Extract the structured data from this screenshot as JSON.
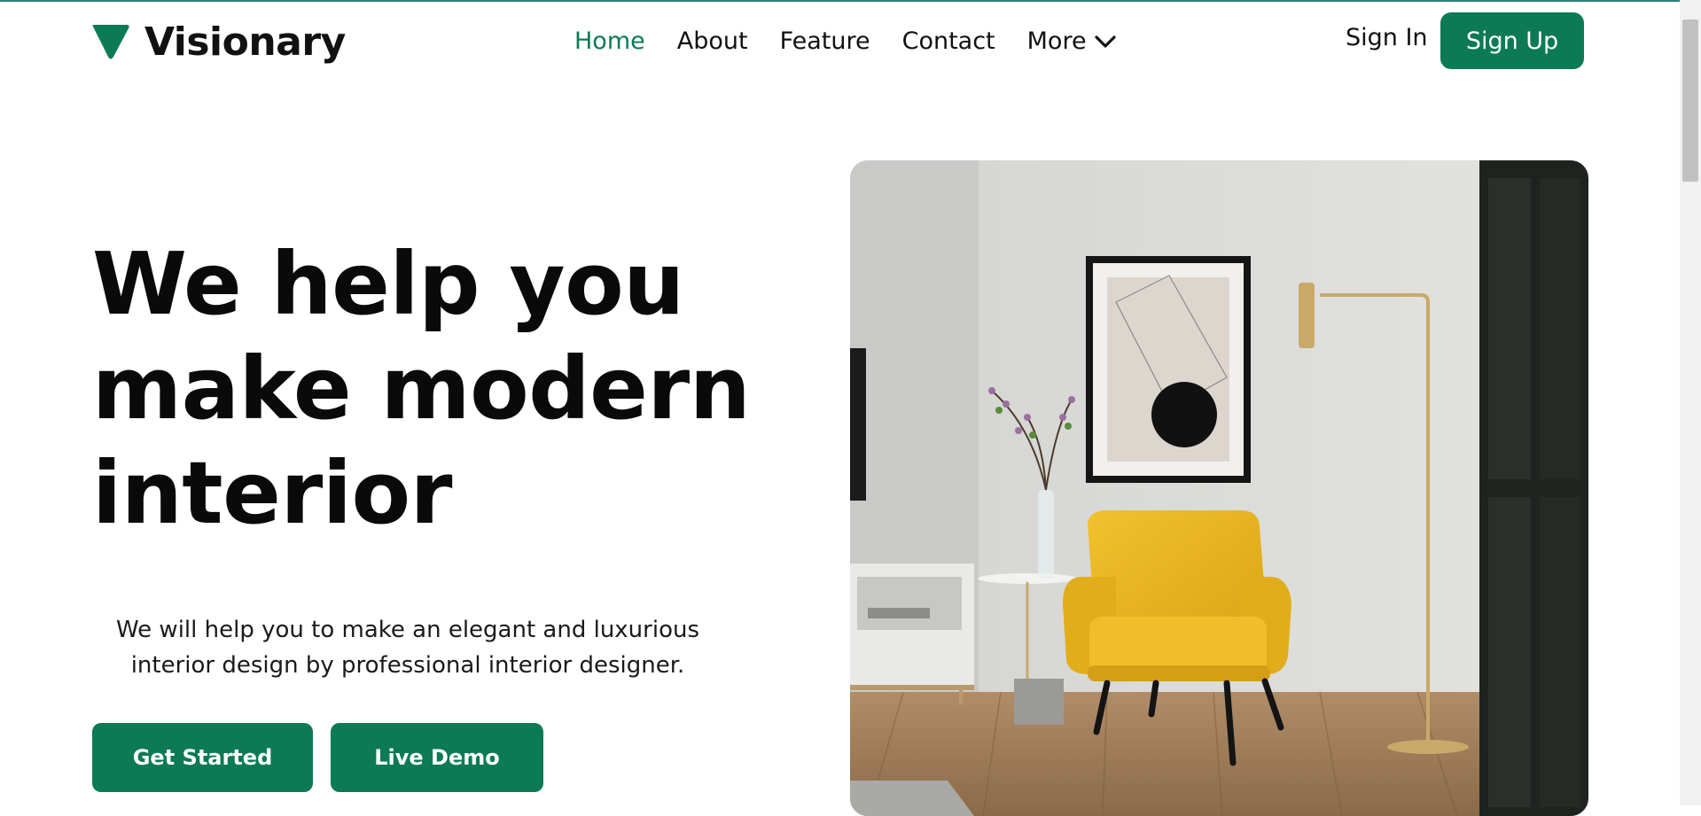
{
  "brand": {
    "name": "Visionary",
    "accent_color": "#0b7a55",
    "logo_icon": "triangle-logo-icon"
  },
  "nav": {
    "items": [
      {
        "label": "Home",
        "active": true
      },
      {
        "label": "About",
        "active": false
      },
      {
        "label": "Feature",
        "active": false
      },
      {
        "label": "Contact",
        "active": false
      }
    ],
    "more_label": "More",
    "more_icon": "chevron-down-icon"
  },
  "auth": {
    "sign_in": "Sign In",
    "sign_up": "Sign Up"
  },
  "hero": {
    "title_lines": [
      "We help you",
      "make modern",
      "interior"
    ],
    "subtitle_lines": [
      "We will help you to make an elegant and luxurious",
      "interior design by professional interior designer."
    ],
    "primary_button": "Get Started",
    "secondary_button": "Live Demo",
    "image": "interior-room-photo"
  }
}
